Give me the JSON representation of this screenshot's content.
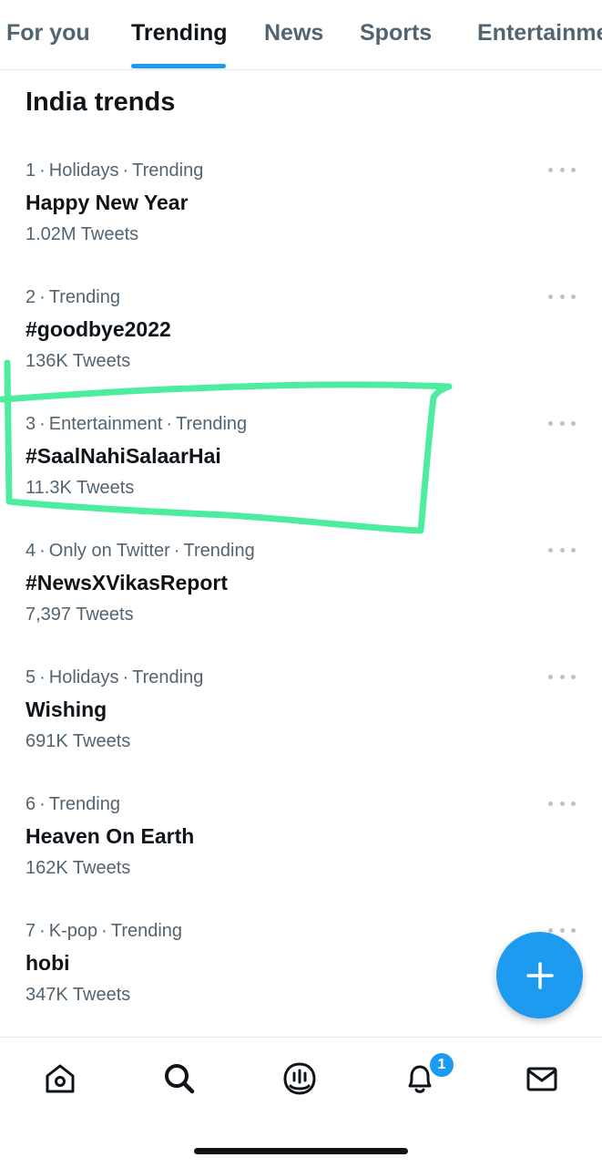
{
  "tabs": [
    {
      "label": "For you",
      "active": false
    },
    {
      "label": "Trending",
      "active": true
    },
    {
      "label": "News",
      "active": false
    },
    {
      "label": "Sports",
      "active": false
    },
    {
      "label": "Entertainment",
      "active": false
    }
  ],
  "section": {
    "title": "India trends"
  },
  "trends": [
    {
      "rank": "1",
      "context": "Holidays",
      "status": "Trending",
      "title": "Happy New Year",
      "count": "1.02M Tweets"
    },
    {
      "rank": "2",
      "context": "",
      "status": "Trending",
      "title": "#goodbye2022",
      "count": "136K Tweets"
    },
    {
      "rank": "3",
      "context": "Entertainment",
      "status": "Trending",
      "title": "#SaalNahiSalaarHai",
      "count": "11.3K Tweets"
    },
    {
      "rank": "4",
      "context": "Only on Twitter",
      "status": "Trending",
      "title": "#NewsXVikasReport",
      "count": "7,397 Tweets"
    },
    {
      "rank": "5",
      "context": "Holidays",
      "status": "Trending",
      "title": "Wishing",
      "count": "691K Tweets"
    },
    {
      "rank": "6",
      "context": "",
      "status": "Trending",
      "title": "Heaven On Earth",
      "count": "162K Tweets"
    },
    {
      "rank": "7",
      "context": "K-pop",
      "status": "Trending",
      "title": "hobi",
      "count": "347K Tweets"
    }
  ],
  "bottom_nav": {
    "items": [
      "home-icon",
      "search-icon",
      "spaces-icon",
      "notifications-icon",
      "messages-icon"
    ],
    "notifications_badge": "1"
  },
  "colors": {
    "accent": "#1d9bf0",
    "text_primary": "#0f1419",
    "text_secondary": "#536471",
    "highlight_annotation": "#4ded9f"
  }
}
